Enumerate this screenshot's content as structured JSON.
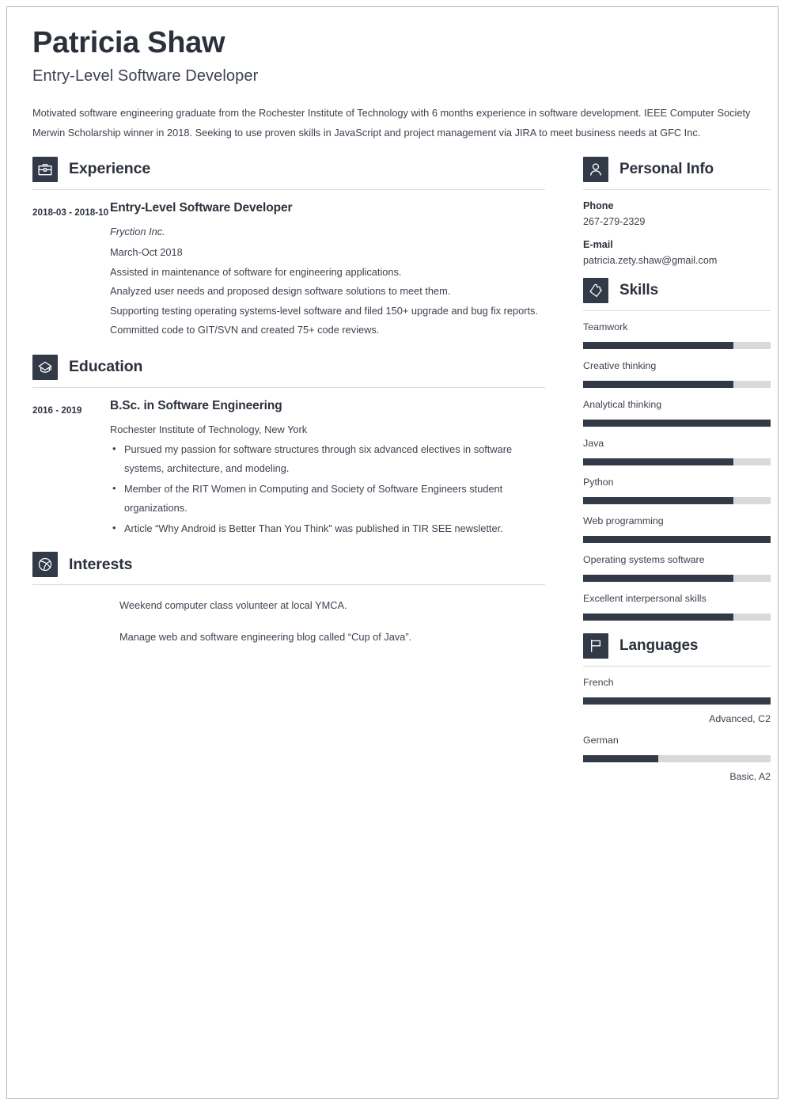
{
  "header": {
    "name": "Patricia Shaw",
    "job_title": "Entry-Level Software Developer",
    "summary": "Motivated software engineering graduate from the Rochester Institute of Technology with 6 months experience in software development. IEEE Computer Society Merwin Scholarship winner in 2018. Seeking to use proven skills in JavaScript and project management via JIRA to meet business needs at GFC Inc."
  },
  "colors": {
    "accent_dark": "#333a47",
    "text": "#3d424e",
    "heading": "#2b303b",
    "bar_track": "#d9d9d9",
    "rule": "#dcdcdc",
    "page_border": "#b9b9b9"
  },
  "experience": {
    "title": "Experience",
    "icon": "briefcase-icon",
    "entries": [
      {
        "dates": "2018-03 - 2018-10",
        "title": "Entry-Level Software Developer",
        "company": "Fryction Inc.",
        "period": "March-Oct 2018",
        "lines": [
          "Assisted in maintenance of software for engineering applications.",
          "Analyzed user needs and proposed design software solutions to meet them.",
          "Supporting testing operating systems-level software and filed 150+ upgrade and bug fix reports.",
          "Committed code to GIT/SVN and created 75+ code reviews."
        ]
      }
    ]
  },
  "education": {
    "title": "Education",
    "icon": "graduation-cap-icon",
    "entries": [
      {
        "dates": "2016 - 2019",
        "title": "B.Sc. in Software Engineering",
        "school": "Rochester Institute of Technology, New York",
        "bullets": [
          "Pursued my passion for software structures through six advanced electives in software systems, architecture, and modeling.",
          "Member of the RIT Women in Computing and Society of Software Engineers student organizations.",
          "Article “Why Android is Better Than You Think” was published in TIR SEE newsletter."
        ]
      }
    ]
  },
  "interests": {
    "title": "Interests",
    "icon": "basketball-icon",
    "items": [
      "Weekend computer class volunteer at local YMCA.",
      "Manage web and software engineering blog called “Cup of Java”."
    ]
  },
  "personal_info": {
    "title": "Personal Info",
    "icon": "person-icon",
    "fields": [
      {
        "label": "Phone",
        "value": "267-279-2329"
      },
      {
        "label": "E-mail",
        "value": "patricia.zety.shaw@gmail.com"
      }
    ]
  },
  "skills": {
    "title": "Skills",
    "icon": "puzzle-piece-icon",
    "items": [
      {
        "name": "Teamwork",
        "level": 80
      },
      {
        "name": "Creative thinking",
        "level": 80
      },
      {
        "name": "Analytical thinking",
        "level": 100
      },
      {
        "name": "Java",
        "level": 80
      },
      {
        "name": "Python",
        "level": 80
      },
      {
        "name": "Web programming",
        "level": 100
      },
      {
        "name": "Operating systems software",
        "level": 80
      },
      {
        "name": "Excellent interpersonal skills",
        "level": 80
      }
    ]
  },
  "languages": {
    "title": "Languages",
    "icon": "flag-icon",
    "items": [
      {
        "name": "French",
        "level": 100,
        "level_label": "Advanced, C2"
      },
      {
        "name": "German",
        "level": 40,
        "level_label": "Basic, A2"
      }
    ]
  }
}
